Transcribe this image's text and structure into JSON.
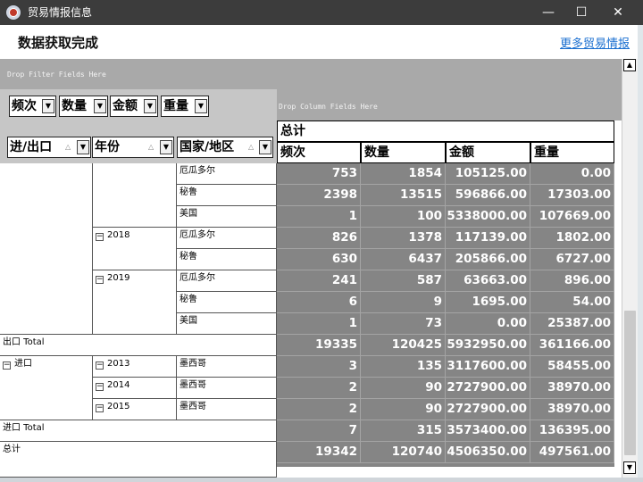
{
  "window": {
    "title": "贸易情报信息",
    "controls": {
      "minimize": "—",
      "maximize": "☐",
      "close": "✕"
    }
  },
  "header": {
    "status": "数据获取完成",
    "more_link": "更多贸易情报"
  },
  "pivot": {
    "filter_hint": "Drop Filter Fields Here",
    "column_hint": "Drop Column Fields Here",
    "data_fields": [
      "频次",
      "数量",
      "金额",
      "重量"
    ],
    "row_fields": [
      "进/出口",
      "年份",
      "国家/地区"
    ],
    "grand_header": "总计",
    "measures": [
      "频次",
      "数量",
      "金额",
      "重量"
    ],
    "row_headers": {
      "ecuador_1": "厄瓜多尔",
      "peru_1": "秘鲁",
      "usa_1": "美国",
      "year_2018": "2018",
      "ecuador_2018": "厄瓜多尔",
      "peru_2018": "秘鲁",
      "year_2019": "2019",
      "ecuador_2019": "厄瓜多尔",
      "peru_2019": "秘鲁",
      "usa_2019": "美国",
      "export_total": "出口 Total",
      "import": "进口",
      "year_2013": "2013",
      "mexico_2013": "墨西哥",
      "year_2014": "2014",
      "mexico_2014": "墨西哥",
      "year_2015": "2015",
      "mexico_2015": "墨西哥",
      "import_total": "进口 Total",
      "grand_total": "总计"
    },
    "rows": [
      [
        "753",
        "1854",
        "105125.00",
        "0.00"
      ],
      [
        "2398",
        "13515",
        "596866.00",
        "17303.00"
      ],
      [
        "1",
        "100",
        "5338000.00",
        "107669.00"
      ],
      [
        "826",
        "1378",
        "117139.00",
        "1802.00"
      ],
      [
        "630",
        "6437",
        "205866.00",
        "6727.00"
      ],
      [
        "241",
        "587",
        "63663.00",
        "896.00"
      ],
      [
        "6",
        "9",
        "1695.00",
        "54.00"
      ],
      [
        "1",
        "73",
        "0.00",
        "25387.00"
      ],
      [
        "19335",
        "120425",
        "5932950.00",
        "361166.00"
      ],
      [
        "3",
        "135",
        "3117600.00",
        "58455.00"
      ],
      [
        "2",
        "90",
        "2727900.00",
        "38970.00"
      ],
      [
        "2",
        "90",
        "2727900.00",
        "38970.00"
      ],
      [
        "7",
        "315",
        "3573400.00",
        "136395.00"
      ],
      [
        "19342",
        "120740",
        "4506350.00",
        "497561.00"
      ]
    ]
  },
  "scrollbar": {
    "up": "▲",
    "down": "▼"
  }
}
